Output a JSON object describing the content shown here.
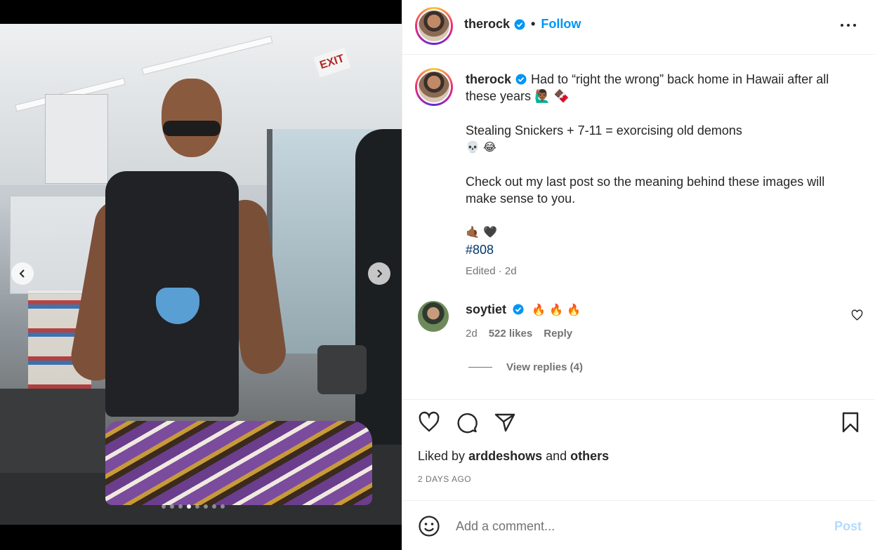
{
  "post": {
    "username": "therock",
    "follow_label": "Follow",
    "separator": "•",
    "caption_lines": [
      "Had to “right the wrong” back home in Hawaii after all these years 🙋🏾‍♂️ 🍫",
      "",
      "Stealing Snickers + 7-11 = exorcising old demons",
      "💀 😂",
      "",
      "Check out my last post so the meaning behind these images will make sense to you.",
      "",
      "🤙🏾 🖤"
    ],
    "hashtag": "#808",
    "edited": "Edited · 2d"
  },
  "media": {
    "exit_sign": "EXIT",
    "slide_count": 8,
    "active_slide": 3
  },
  "comment": {
    "username": "soytiet",
    "text": "🔥 🔥 🔥",
    "age": "2d",
    "likes": "522 likes",
    "reply_label": "Reply",
    "view_replies": "View replies (4)"
  },
  "engagement": {
    "liked_by_prefix": "Liked by",
    "liked_by_user": "arddeshows",
    "liked_by_and": "and",
    "liked_by_others": "others",
    "date": "2 DAYS AGO"
  },
  "composer": {
    "placeholder": "Add a comment...",
    "post_label": "Post"
  },
  "colors": {
    "accent": "#0095f6",
    "hashtag": "#00376b",
    "muted": "#737373",
    "post_disabled": "#b3dbff"
  },
  "icons": {
    "verified": "verified-badge-icon",
    "more": "more-horizontal-icon",
    "like": "heart-icon",
    "comment": "comment-bubble-icon",
    "share": "paper-plane-icon",
    "save": "bookmark-icon",
    "emoji": "smiley-icon",
    "prev": "chevron-left-icon",
    "next": "chevron-right-icon"
  }
}
